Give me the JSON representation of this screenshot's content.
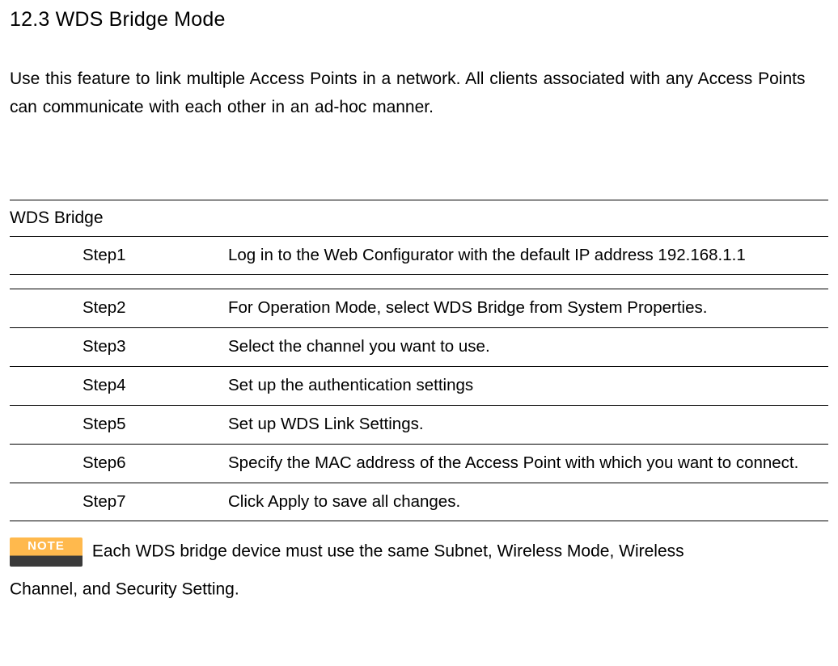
{
  "heading": "12.3 WDS Bridge Mode",
  "intro": "Use this feature to link multiple Access Points in a network. All clients associated with any Access Points can communicate with each other in an ad-hoc manner.",
  "table": {
    "header": "WDS Bridge",
    "steps": [
      {
        "label": "Step1",
        "desc": "Log in to the Web Configurator with the default IP address 192.168.1.1"
      },
      {
        "label": "Step2",
        "desc": "For Operation Mode, select WDS Bridge from System Properties."
      },
      {
        "label": "Step3",
        "desc": "Select the channel you want to use."
      },
      {
        "label": "Step4",
        "desc": "Set up the authentication settings"
      },
      {
        "label": "Step5",
        "desc": "Set up WDS Link Settings."
      },
      {
        "label": "Step6",
        "desc": "Specify the MAC address of the Access Point with which you want to connect."
      },
      {
        "label": "Step7",
        "desc": "Click Apply to save all changes."
      }
    ]
  },
  "note": {
    "badge": "NOTE",
    "text1": "Each WDS bridge device must use the same Subnet, Wireless Mode, Wireless",
    "text2": "Channel, and Security Setting."
  }
}
